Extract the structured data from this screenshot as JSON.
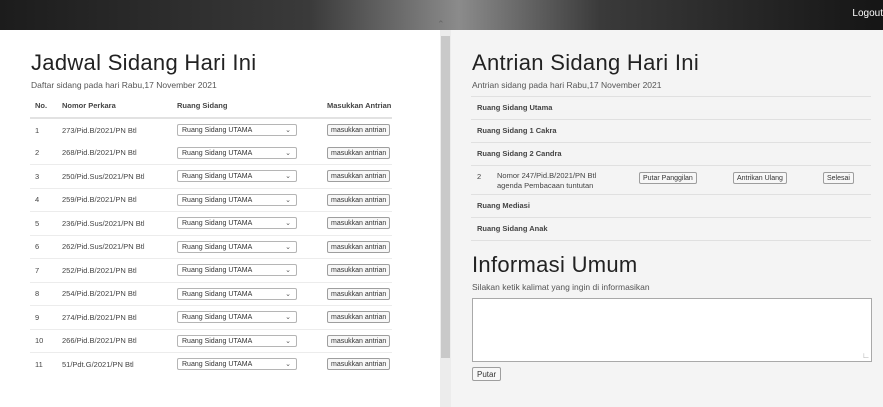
{
  "header": {
    "logout_label": "Logout"
  },
  "left": {
    "title": "Jadwal Sidang Hari Ini",
    "subtitle": "Daftar sidang pada hari Rabu,17 November 2021",
    "columns": [
      "No.",
      "Nomor Perkara",
      "Ruang Sidang",
      "Masukkan Antrian"
    ],
    "rows": [
      {
        "no": "1",
        "perkara": "273/Pid.B/2021/PN Btl",
        "ruang": "Ruang Sidang UTAMA",
        "action": "masukkan antrian"
      },
      {
        "no": "2",
        "perkara": "268/Pid.B/2021/PN Btl",
        "ruang": "Ruang Sidang UTAMA",
        "action": "masukkan antrian"
      },
      {
        "no": "3",
        "perkara": "250/Pid.Sus/2021/PN Btl",
        "ruang": "Ruang Sidang UTAMA",
        "action": "masukkan antrian"
      },
      {
        "no": "4",
        "perkara": "259/Pid.B/2021/PN Btl",
        "ruang": "Ruang Sidang UTAMA",
        "action": "masukkan antrian"
      },
      {
        "no": "5",
        "perkara": "236/Pid.Sus/2021/PN Btl",
        "ruang": "Ruang Sidang UTAMA",
        "action": "masukkan antrian"
      },
      {
        "no": "6",
        "perkara": "262/Pid.Sus/2021/PN Btl",
        "ruang": "Ruang Sidang UTAMA",
        "action": "masukkan antrian"
      },
      {
        "no": "7",
        "perkara": "252/Pid.B/2021/PN Btl",
        "ruang": "Ruang Sidang UTAMA",
        "action": "masukkan antrian"
      },
      {
        "no": "8",
        "perkara": "254/Pid.B/2021/PN Btl",
        "ruang": "Ruang Sidang UTAMA",
        "action": "masukkan antrian"
      },
      {
        "no": "9",
        "perkara": "274/Pid.B/2021/PN Btl",
        "ruang": "Ruang Sidang UTAMA",
        "action": "masukkan antrian"
      },
      {
        "no": "10",
        "perkara": "266/Pid.B/2021/PN Btl",
        "ruang": "Ruang Sidang UTAMA",
        "action": "masukkan antrian"
      },
      {
        "no": "11",
        "perkara": "51/Pdt.G/2021/PN Btl",
        "ruang": "Ruang Sidang UTAMA",
        "action": "masukkan antrian"
      }
    ]
  },
  "right": {
    "title": "Antrian Sidang Hari Ini",
    "subtitle": "Antrian sidang pada hari Rabu,17 November 2021",
    "rooms": {
      "utama": "Ruang Sidang Utama",
      "cakra": "Ruang Sidang 1 Cakra",
      "candra": "Ruang Sidang 2 Candra",
      "mediasi": "Ruang Mediasi",
      "anak": "Ruang Sidang Anak"
    },
    "queue_item": {
      "no": "2",
      "line1": "Nomor 247/Pid.B/2021/PN Btl",
      "line2": "agenda Pembacaan tuntutan",
      "btn_putar": "Putar Panggilan",
      "btn_ulang": "Antrikan Ulang",
      "btn_selesai": "Selesai"
    },
    "info_title": "Informasi Umum",
    "info_subtitle": "Silakan ketik kalimat yang ingin di informasikan",
    "info_value": "",
    "putar_label": "Putar"
  },
  "icons": [
    "chevron-down-icon",
    "resize-grip-icon"
  ]
}
